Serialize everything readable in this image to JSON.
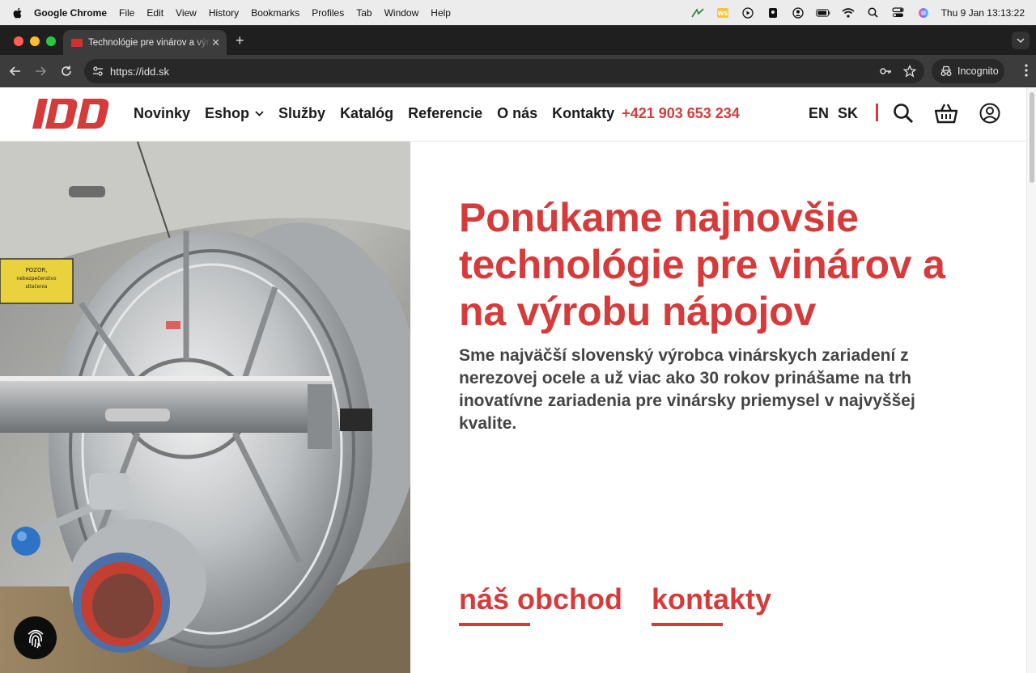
{
  "menubar": {
    "app_name": "Google Chrome",
    "items": [
      "File",
      "Edit",
      "View",
      "History",
      "Bookmarks",
      "Profiles",
      "Tab",
      "Window",
      "Help"
    ],
    "clock": "Thu 9 Jan  13:13:22"
  },
  "browser": {
    "tab_title": "Technológie pre vinárov a výrobu nápojov",
    "url": "https://idd.sk",
    "incognito_label": "Incognito"
  },
  "site": {
    "logo_text": "IDD",
    "nav": [
      "Novinky",
      "Eshop",
      "Služby",
      "Katalóg",
      "Referencie",
      "O nás",
      "Kontakty"
    ],
    "phone": "+421 903 653 234",
    "lang_en": "EN",
    "lang_sk": "SK",
    "headline": "Ponúkame najnovšie technológie pre vinárov a na výrobu nápojov",
    "subline": "Sme najväčší slovenský výrobca vinárskych zariadení z nerezovej ocele a už viac ako 30 rokov prinášame na trh inovatívne zariadenia pre vinársky priemysel v najvyššej kvalite.",
    "cta_shop": "náš obchod",
    "cta_contacts": "kontakty",
    "warning_label": "POZOR, nebezpečenstvo, stlačenia"
  },
  "colors": {
    "brand_red": "#d63b3b",
    "chrome_dark": "#1f1f1f"
  }
}
